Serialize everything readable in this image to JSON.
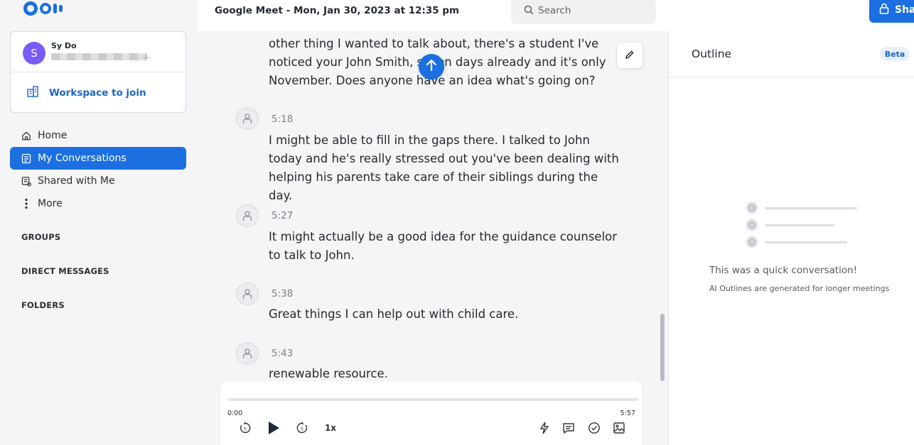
{
  "app": {
    "logo": "Otter"
  },
  "user": {
    "initial": "S",
    "name": "Sy Do",
    "email_suffix": "..."
  },
  "workspace": {
    "label": "Workspace to join"
  },
  "nav": [
    {
      "label": "Home",
      "icon": "home-icon"
    },
    {
      "label": "My Conversations",
      "icon": "conversations-icon",
      "active": true
    },
    {
      "label": "Shared with Me",
      "icon": "shared-icon"
    },
    {
      "label": "More",
      "icon": "more-icon"
    }
  ],
  "sections": {
    "groups": "GROUPS",
    "direct_messages": "DIRECT MESSAGES",
    "folders": "FOLDERS"
  },
  "header": {
    "title": "Google Meet - Mon, Jan 30, 2023 at 12:35 pm",
    "search_placeholder": "Search",
    "share_label": "Share"
  },
  "transcript": {
    "partial_text": "other thing I wanted to talk about, there's a student I've noticed your John Smith, seven days already and it's only November. Does anyone have an idea what's going on?",
    "entries": [
      {
        "time": "5:18",
        "text": "I might be able to fill in the gaps there. I talked to John today and he's really stressed out you've been dealing with helping his parents take care of their siblings during the day."
      },
      {
        "time": "5:27",
        "text": "It might actually be a good idea for the guidance counselor to talk to John."
      },
      {
        "time": "5:38",
        "text": "Great things I can help out with child care."
      },
      {
        "time": "5:43",
        "text": "renewable resource."
      }
    ]
  },
  "player": {
    "current_time": "0:00",
    "duration": "5:57",
    "speed": "1x",
    "progress": 0
  },
  "outline": {
    "title": "Outline",
    "badge": "Beta",
    "empty_title": "This was a quick conversation!",
    "empty_subtitle": "AI Outlines are generated for longer meetings"
  },
  "colors": {
    "accent": "#1b6fe0",
    "avatar": "#7a5af8",
    "sidebar_bg": "#f5f5f7"
  }
}
